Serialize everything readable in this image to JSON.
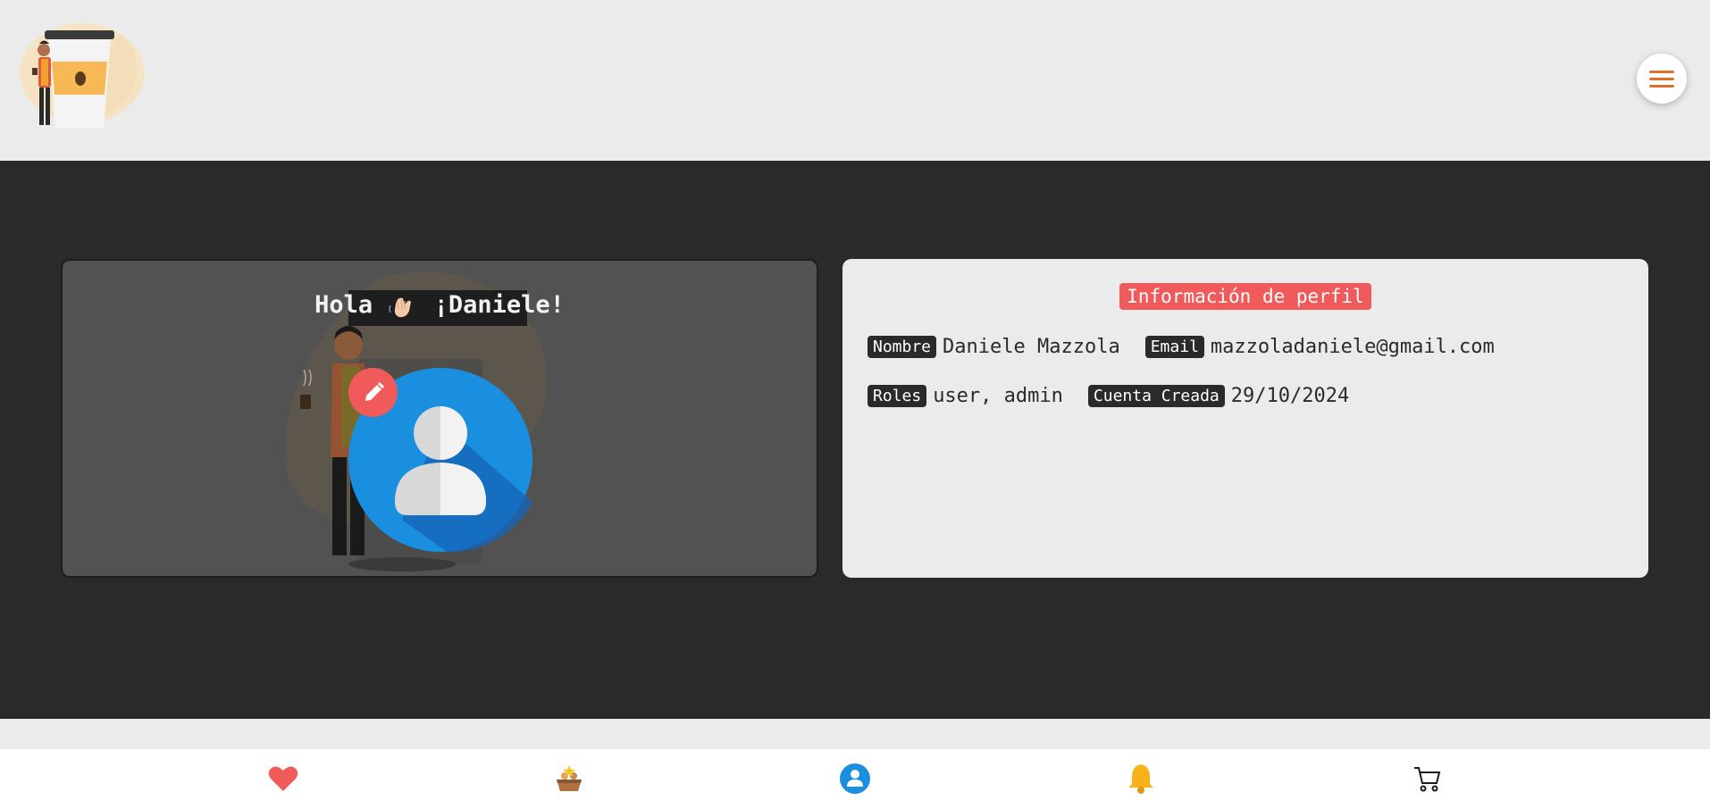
{
  "header": {
    "logo": "coffee-person-logo",
    "menu_icon": "hamburger-icon"
  },
  "profile_card": {
    "greeting_prefix": "Hola",
    "greeting_name": "¡Daniele!",
    "wave_icon": "waving-hand-icon",
    "avatar_icon": "user-avatar-icon",
    "edit_icon": "pencil-icon"
  },
  "info_card": {
    "title": "Información de perfil",
    "fields": {
      "name_label": "Nombre",
      "name_value": "Daniele Mazzola",
      "email_label": "Email",
      "email_value": "mazzoladaniele@gmail.com",
      "roles_label": "Roles",
      "roles_value": "user, admin",
      "created_label": "Cuenta Creada",
      "created_value": "29/10/2024"
    }
  },
  "bottom_nav": {
    "items": [
      "heart-icon",
      "basket-icon",
      "profile-icon",
      "bell-icon",
      "cart-icon"
    ]
  },
  "colors": {
    "accent_red": "#f05a5a",
    "dark_bg": "#2a2a2a",
    "light_bg": "#ebebeb",
    "menu_orange": "#e0702a",
    "profile_blue": "#1a8fe0",
    "bell_yellow": "#f5b21a"
  }
}
